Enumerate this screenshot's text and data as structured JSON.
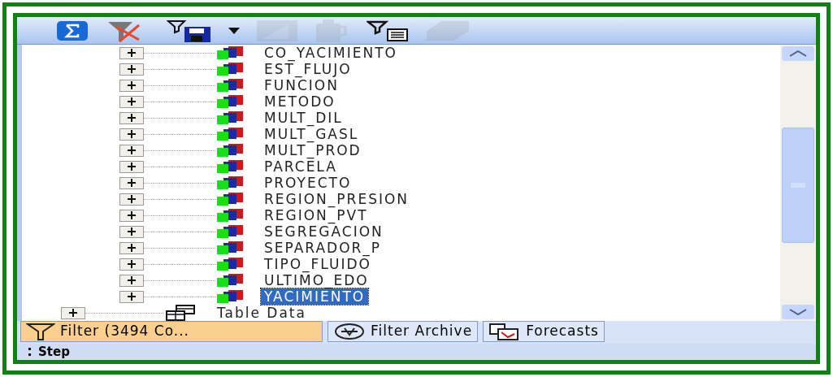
{
  "toolbar": [
    {
      "kind": "sigma",
      "disabled": false
    },
    {
      "kind": "clear-filter",
      "disabled": false
    },
    {
      "kind": "save-filter",
      "disabled": false
    },
    {
      "kind": "caret",
      "disabled": false
    },
    {
      "kind": "chart",
      "disabled": true
    },
    {
      "kind": "mug",
      "disabled": true
    },
    {
      "kind": "filter-list",
      "disabled": false
    },
    {
      "kind": "diamond",
      "disabled": true
    }
  ],
  "tree": {
    "rows": [
      {
        "kind": "field",
        "label": "CO_YACIMIENTO",
        "expanded": false,
        "selected": false
      },
      {
        "kind": "field",
        "label": "EST_FLUJO",
        "expanded": false,
        "selected": false
      },
      {
        "kind": "field",
        "label": "FUNCION",
        "expanded": false,
        "selected": false
      },
      {
        "kind": "field",
        "label": "METODO",
        "expanded": false,
        "selected": false
      },
      {
        "kind": "field",
        "label": "MULT_DIL",
        "expanded": false,
        "selected": false
      },
      {
        "kind": "field",
        "label": "MULT_GASL",
        "expanded": false,
        "selected": false
      },
      {
        "kind": "field",
        "label": "MULT_PROD",
        "expanded": false,
        "selected": false
      },
      {
        "kind": "field",
        "label": "PARCELA",
        "expanded": false,
        "selected": false
      },
      {
        "kind": "field",
        "label": "PROYECTO",
        "expanded": false,
        "selected": false
      },
      {
        "kind": "field",
        "label": "REGION_PRESION",
        "expanded": false,
        "selected": false
      },
      {
        "kind": "field",
        "label": "REGION_PVT",
        "expanded": false,
        "selected": false
      },
      {
        "kind": "field",
        "label": "SEGREGACION",
        "expanded": false,
        "selected": false
      },
      {
        "kind": "field",
        "label": "SEPARADOR_P",
        "expanded": false,
        "selected": false
      },
      {
        "kind": "field",
        "label": "TIPO_FLUIDO",
        "expanded": false,
        "selected": false
      },
      {
        "kind": "field",
        "label": "ULTIMO_EDO",
        "expanded": false,
        "selected": false
      },
      {
        "kind": "field",
        "label": "YACIMIENTO",
        "expanded": false,
        "selected": true
      },
      {
        "kind": "table",
        "label": "Table Data",
        "expanded": false,
        "selected": false
      }
    ]
  },
  "tabs": [
    {
      "kind": "filter",
      "label": "Filter (3494 Co...",
      "selected": true
    },
    {
      "kind": "archive",
      "label": "Filter Archive",
      "selected": false
    },
    {
      "kind": "forecasts",
      "label": "Forecasts",
      "selected": false
    }
  ],
  "panel": {
    "title": "Step"
  }
}
